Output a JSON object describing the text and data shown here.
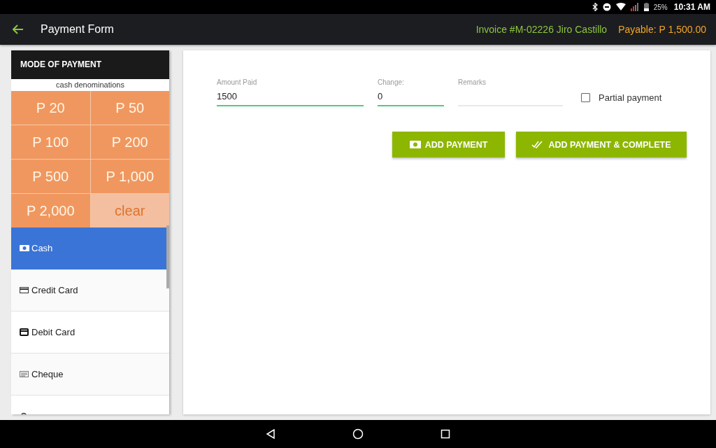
{
  "status_bar": {
    "battery": "25%",
    "time": "10:31 AM"
  },
  "app_bar": {
    "title": "Payment Form",
    "invoice": "Invoice #M-02226 Jiro Castillo",
    "payable": "Payable: P 1,500.00"
  },
  "sidebar": {
    "title": "MODE OF PAYMENT",
    "subtitle": "cash denominations",
    "denominations": [
      {
        "label": "P 20",
        "kind": "amount"
      },
      {
        "label": "P 50",
        "kind": "amount"
      },
      {
        "label": "P 100",
        "kind": "amount"
      },
      {
        "label": "P 200",
        "kind": "amount"
      },
      {
        "label": "P 500",
        "kind": "amount"
      },
      {
        "label": "P 1,000",
        "kind": "amount"
      },
      {
        "label": "P 2,000",
        "kind": "amount"
      },
      {
        "label": "clear",
        "kind": "clear"
      }
    ],
    "methods": [
      {
        "label": "Cash",
        "kind": "cash",
        "selected": true
      },
      {
        "label": "Credit Card",
        "kind": "credit",
        "selected": false
      },
      {
        "label": "Debit Card",
        "kind": "debit",
        "selected": false
      },
      {
        "label": "Cheque",
        "kind": "cheque",
        "selected": false
      },
      {
        "kind": "gift",
        "selected": false
      }
    ]
  },
  "form": {
    "fields": [
      {
        "label": "Amount Paid",
        "value": "1500",
        "kind": "wide"
      },
      {
        "label": "Change:",
        "value": "0",
        "kind": "narrow"
      },
      {
        "label": "Remarks",
        "kind": "remarks"
      }
    ],
    "partial_payment": {
      "label": "Partial payment",
      "checked": false
    },
    "buttons": [
      {
        "label": "ADD PAYMENT",
        "kind": "add"
      },
      {
        "label": "ADD PAYMENT & COMPLETE",
        "kind": "complete"
      }
    ]
  }
}
